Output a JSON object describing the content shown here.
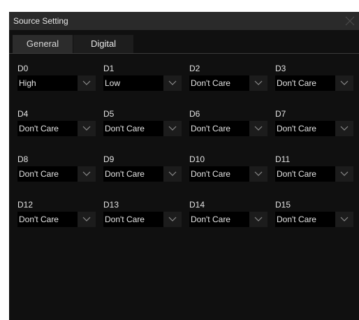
{
  "window": {
    "title": "Source Setting",
    "close_icon": "close-icon"
  },
  "tabs": [
    {
      "label": "General",
      "selected": false
    },
    {
      "label": "Digital",
      "selected": true
    }
  ],
  "channels": [
    {
      "label": "D0",
      "value": "High"
    },
    {
      "label": "D1",
      "value": "Low"
    },
    {
      "label": "D2",
      "value": "Don't Care"
    },
    {
      "label": "D3",
      "value": "Don't Care"
    },
    {
      "label": "D4",
      "value": "Don't Care"
    },
    {
      "label": "D5",
      "value": "Don't Care"
    },
    {
      "label": "D6",
      "value": "Don't Care"
    },
    {
      "label": "D7",
      "value": "Don't Care"
    },
    {
      "label": "D8",
      "value": "Don't Care"
    },
    {
      "label": "D9",
      "value": "Don't Care"
    },
    {
      "label": "D10",
      "value": "Don't Care"
    },
    {
      "label": "D11",
      "value": "Don't Care"
    },
    {
      "label": "D12",
      "value": "Don't Care"
    },
    {
      "label": "D13",
      "value": "Don't Care"
    },
    {
      "label": "D14",
      "value": "Don't Care"
    },
    {
      "label": "D15",
      "value": "Don't Care"
    }
  ],
  "dropdown_icon": "chevron-down-icon",
  "colors": {
    "dialog_background": "#101010",
    "titlebar_background": "#2a2a2a",
    "selected_tab": "#1d1d1d",
    "unselected_tab": "#2c2c2c"
  }
}
